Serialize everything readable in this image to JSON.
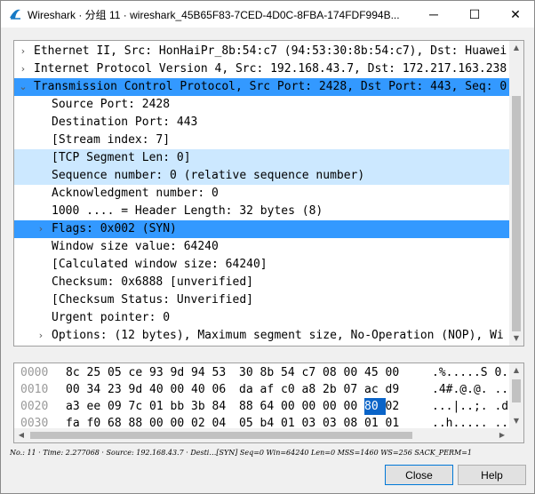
{
  "window": {
    "title": "Wireshark · 分组 11 · wireshark_45B65F83-7CED-4D0C-8FBA-174FDF994B...",
    "controls": {
      "minimize": "─",
      "maximize": "☐",
      "close": "✕"
    }
  },
  "tree": [
    {
      "arrow": "›",
      "text": "Ethernet II, Src: HonHaiPr_8b:54:c7 (94:53:30:8b:54:c7), Dst: Huawei",
      "state": "none"
    },
    {
      "arrow": "›",
      "text": "Internet Protocol Version 4, Src: 192.168.43.7, Dst: 172.217.163.238",
      "state": "none"
    },
    {
      "arrow": "⌄",
      "text": "Transmission Control Protocol, Src Port: 2428, Dst Port: 443, Seq: 0",
      "state": "selected"
    },
    {
      "arrow": "",
      "text": "Source Port: 2428",
      "state": "none"
    },
    {
      "arrow": "",
      "text": "Destination Port: 443",
      "state": "none"
    },
    {
      "arrow": "",
      "text": "[Stream index: 7]",
      "state": "none"
    },
    {
      "arrow": "",
      "text": "[TCP Segment Len: 0]",
      "state": "light"
    },
    {
      "arrow": "",
      "text": "Sequence number: 0    (relative sequence number)",
      "state": "light"
    },
    {
      "arrow": "",
      "text": "Acknowledgment number: 0",
      "state": "none"
    },
    {
      "arrow": "",
      "text": "1000 .... = Header Length: 32 bytes (8)",
      "state": "none"
    },
    {
      "arrow": "›",
      "text": "Flags: 0x002 (SYN)",
      "state": "selected"
    },
    {
      "arrow": "",
      "text": "Window size value: 64240",
      "state": "none"
    },
    {
      "arrow": "",
      "text": "[Calculated window size: 64240]",
      "state": "none"
    },
    {
      "arrow": "",
      "text": "Checksum: 0x6888 [unverified]",
      "state": "none"
    },
    {
      "arrow": "",
      "text": "[Checksum Status: Unverified]",
      "state": "none"
    },
    {
      "arrow": "",
      "text": "Urgent pointer: 0",
      "state": "none"
    },
    {
      "arrow": "›",
      "text": "Options: (12 bytes), Maximum segment size, No-Operation (NOP), Wi",
      "state": "none"
    }
  ],
  "bytes": [
    {
      "offset": "0000",
      "hex": [
        "8c",
        "25",
        "05",
        "ce",
        "93",
        "9d",
        "94",
        "53",
        "30",
        "8b",
        "54",
        "c7",
        "08",
        "00",
        "45",
        "00"
      ],
      "ascii": ".%.....S 0.",
      "highlight": -1
    },
    {
      "offset": "0010",
      "hex": [
        "00",
        "34",
        "23",
        "9d",
        "40",
        "00",
        "40",
        "06",
        "da",
        "af",
        "c0",
        "a8",
        "2b",
        "07",
        "ac",
        "d9"
      ],
      "ascii": ".4#.@.@. ..",
      "highlight": -1
    },
    {
      "offset": "0020",
      "hex": [
        "a3",
        "ee",
        "09",
        "7c",
        "01",
        "bb",
        "3b",
        "84",
        "88",
        "64",
        "00",
        "00",
        "00",
        "00",
        "80",
        "02"
      ],
      "ascii": "...|..;. .d",
      "highlight": 14
    },
    {
      "offset": "0030",
      "hex": [
        "fa",
        "f0",
        "68",
        "88",
        "00",
        "00",
        "02",
        "04",
        "05",
        "b4",
        "01",
        "03",
        "03",
        "08",
        "01",
        "01"
      ],
      "ascii": "..h..... ..",
      "highlight": -1
    }
  ],
  "status": "No.: 11 · Time: 2.277068 · Source: 192.168.43.7 · Desti…[SYN] Seq=0 Win=64240 Len=0 MSS=1460 WS=256 SACK_PERM=1",
  "buttons": {
    "close": "Close",
    "help": "Help"
  },
  "colors": {
    "selected": "#3399ff",
    "light": "#cce8ff",
    "byte_highlight": "#0a64c8"
  }
}
